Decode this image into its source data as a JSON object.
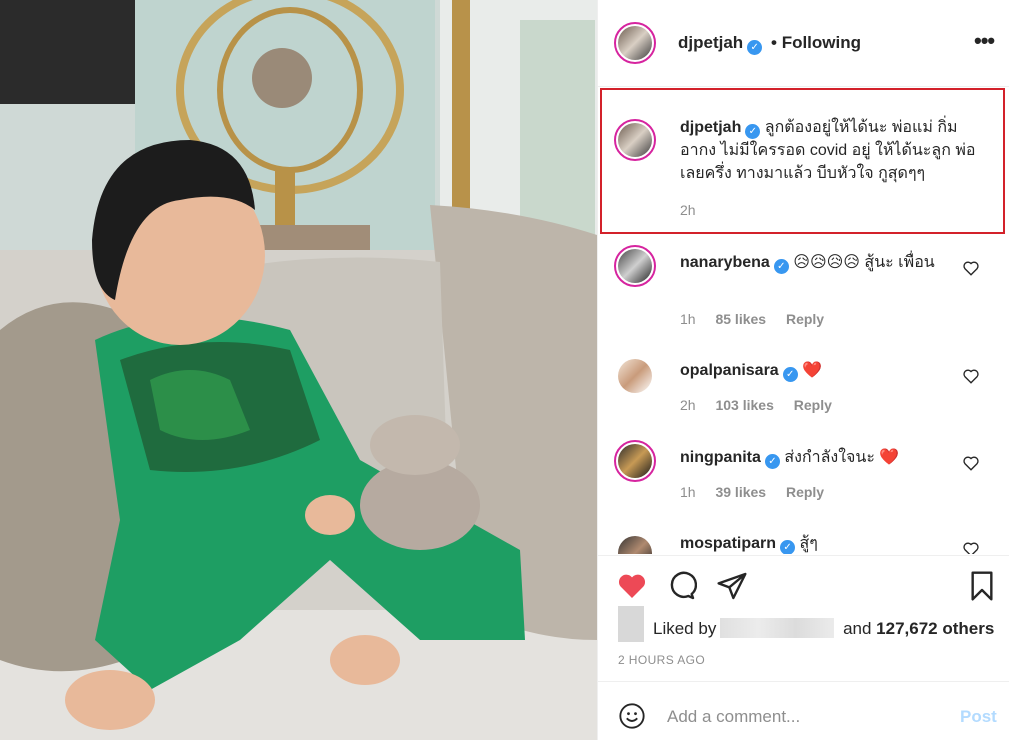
{
  "colors": {
    "accent": "#3897f0",
    "like_red": "#ed4956",
    "highlight_border": "#d3212a",
    "muted": "#8e8e8e"
  },
  "header": {
    "username": "djpetjah",
    "separator": "•",
    "follow_status": "Following",
    "more_label": "•••"
  },
  "caption": {
    "username": "djpetjah",
    "text": "ลูกต้องอยู่ให้ได้นะ พ่อแม่ กิ่ม อากง ไม่มีใครรอด covid อยู่ ให้ได้นะลูก พ่อเลยครึ่ง ทางมาแล้ว บีบหัวใจ กูสุดๆๆ",
    "time": "2h"
  },
  "comments": [
    {
      "username": "nanarybena",
      "text": "😥😥😥😥 สู้นะ เพื่อน",
      "time": "1h",
      "likes": "85 likes",
      "reply": "Reply"
    },
    {
      "username": "opalpanisara",
      "text": "❤️",
      "time": "2h",
      "likes": "103 likes",
      "reply": "Reply"
    },
    {
      "username": "ningpanita",
      "text": "ส่งกำลังใจนะ ❤️",
      "time": "1h",
      "likes": "39 likes",
      "reply": "Reply"
    },
    {
      "username": "mospatiparn",
      "text": "สู้ๆ"
    }
  ],
  "likes": {
    "prefix": "Liked by",
    "and": "and",
    "count": "127,672 others"
  },
  "timestamp": "2 HOURS AGO",
  "comment_input": {
    "placeholder": "Add a comment...",
    "post_label": "Post"
  },
  "icons": [
    "heart-icon",
    "comment-icon",
    "share-icon",
    "bookmark-icon",
    "emoji-icon",
    "more-icon",
    "verified-icon"
  ]
}
